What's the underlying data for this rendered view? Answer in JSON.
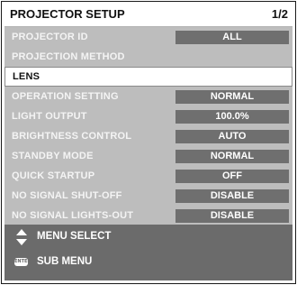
{
  "header": {
    "title": "PROJECTOR SETUP",
    "page": "1/2"
  },
  "menu": {
    "items": [
      {
        "label": "PROJECTOR ID",
        "value": "ALL"
      },
      {
        "label": "PROJECTION METHOD",
        "value": ""
      },
      {
        "label": "LENS",
        "value": ""
      },
      {
        "label": "OPERATION SETTING",
        "value": "NORMAL"
      },
      {
        "label": "LIGHT OUTPUT",
        "value": "100.0%"
      },
      {
        "label": "BRIGHTNESS CONTROL",
        "value": "AUTO"
      },
      {
        "label": "STANDBY MODE",
        "value": "NORMAL"
      },
      {
        "label": "QUICK STARTUP",
        "value": "OFF"
      },
      {
        "label": "NO SIGNAL SHUT-OFF",
        "value": "DISABLE"
      },
      {
        "label": "NO SIGNAL LIGHTS-OUT",
        "value": "DISABLE"
      }
    ],
    "selected_label": "LENS"
  },
  "footer": {
    "select_text": "MENU SELECT",
    "submenu_text": "SUB MENU",
    "enter_icon_text": "ENTER",
    "select_icon": "up-down-arrows-icon"
  }
}
